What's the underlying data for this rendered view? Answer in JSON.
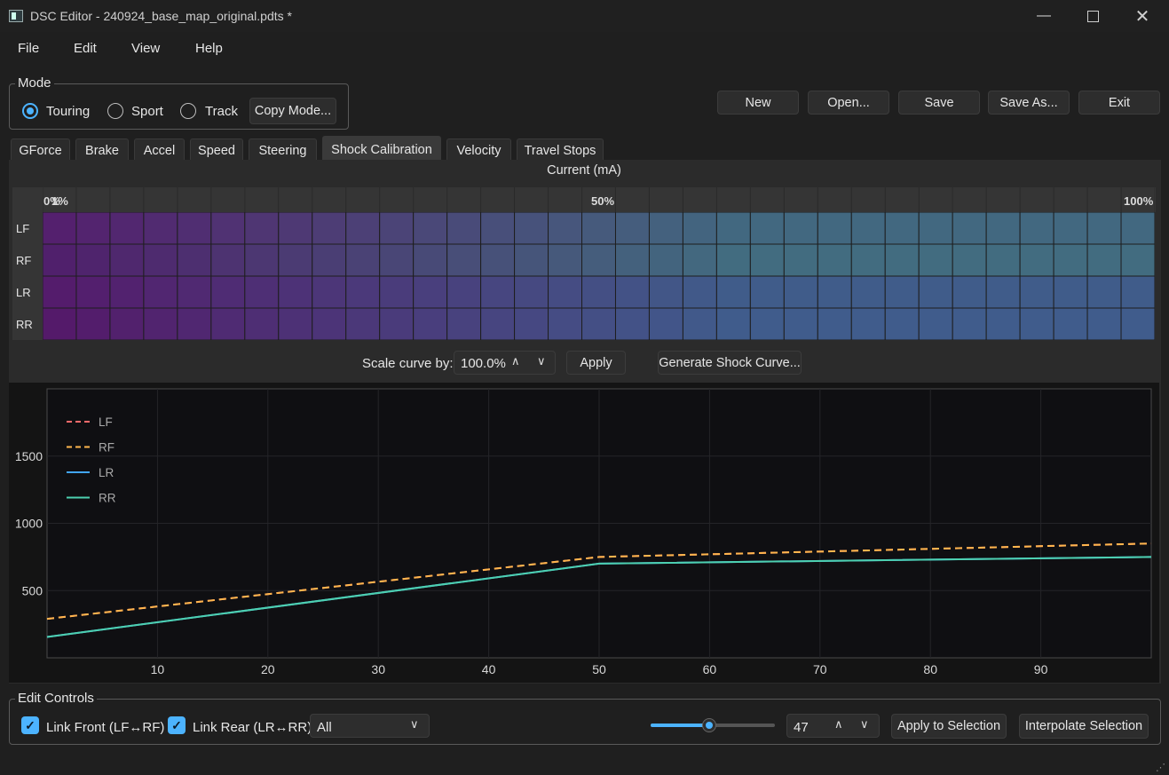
{
  "window": {
    "title": "DSC Editor - 240924_base_map_original.pdts *"
  },
  "menu": [
    "File",
    "Edit",
    "View",
    "Help"
  ],
  "mode": {
    "label": "Mode",
    "options": [
      "Touring",
      "Sport",
      "Track"
    ],
    "selected": "Touring",
    "copy_button": "Copy Mode..."
  },
  "file_buttons": [
    "New",
    "Open...",
    "Save",
    "Save As...",
    "Exit"
  ],
  "tabs": [
    "GForce",
    "Brake",
    "Accel",
    "Speed",
    "Steering",
    "Shock Calibration",
    "Velocity",
    "Travel Stops"
  ],
  "active_tab": "Shock Calibration",
  "heatmap": {
    "title": "Current (mA)",
    "header_labels": {
      "start": "0%",
      "start_overlap": "1%",
      "mid": "50%",
      "end": "100%"
    },
    "rows": [
      "LF",
      "RF",
      "LR",
      "RR"
    ]
  },
  "scale": {
    "label": "Scale curve by:",
    "value": "100.0%",
    "apply": "Apply",
    "generate": "Generate Shock Curve..."
  },
  "chart_data": {
    "type": "line",
    "xlim": [
      0,
      100
    ],
    "ylim": [
      0,
      2000
    ],
    "x_ticks": [
      "10",
      "20",
      "30",
      "40",
      "50",
      "60",
      "70",
      "80",
      "90"
    ],
    "y_ticks": [
      "500",
      "1000",
      "1500"
    ],
    "grid": true,
    "legend_position": "top-left",
    "series": [
      {
        "name": "LF",
        "color": "#ff6b6b",
        "style": "dashed",
        "x": [
          0,
          50,
          100
        ],
        "y": [
          290,
          750,
          850
        ]
      },
      {
        "name": "RF",
        "color": "#ffb74d",
        "style": "dashed",
        "x": [
          0,
          50,
          100
        ],
        "y": [
          290,
          750,
          850
        ]
      },
      {
        "name": "LR",
        "color": "#42a5f5",
        "style": "solid",
        "x": [
          0,
          50,
          100
        ],
        "y": [
          155,
          700,
          750
        ]
      },
      {
        "name": "RR",
        "color": "#4dd0b0",
        "style": "solid",
        "x": [
          0,
          50,
          100
        ],
        "y": [
          155,
          700,
          750
        ]
      }
    ]
  },
  "edit_controls": {
    "label": "Edit Controls",
    "link_front": "Link Front (LF↔RF)",
    "link_rear": "Link Rear (LR↔RR)",
    "combo_value": "All",
    "slider_value": 47,
    "spin_value": "47",
    "apply_selection": "Apply to Selection",
    "interpolate_selection": "Interpolate Selection"
  }
}
